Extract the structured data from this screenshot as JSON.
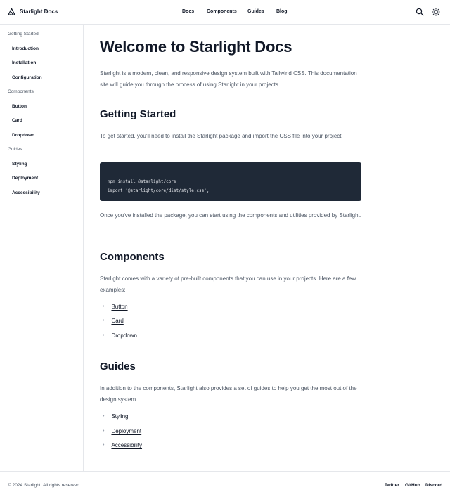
{
  "header": {
    "brand": "Starlight Docs",
    "nav": [
      "Docs",
      "Components",
      "Guides",
      "Blog"
    ],
    "icons": [
      "search-icon",
      "sun-icon"
    ]
  },
  "sidebar": {
    "sections": [
      {
        "title": "Getting Started",
        "items": [
          "Introduction",
          "Installation",
          "Configuration"
        ]
      },
      {
        "title": "Components",
        "items": [
          "Button",
          "Card",
          "Dropdown"
        ]
      },
      {
        "title": "Guides",
        "items": [
          "Styling",
          "Deployment",
          "Accessibility"
        ]
      }
    ]
  },
  "main": {
    "title": "Welcome to Starlight Docs",
    "intro": "Starlight is a modern, clean, and responsive design system built with Tailwind CSS. This documentation site will guide you through the process of using Starlight in your projects.",
    "getting_started": {
      "heading": "Getting Started",
      "text": "To get started, you'll need to install the Starlight package and import the CSS file into your project.",
      "code": [
        "npm install @starlight/core",
        "import '@starlight/core/dist/style.css';"
      ],
      "after": "Once you've installed the package, you can start using the components and utilities provided by Starlight."
    },
    "components": {
      "heading": "Components",
      "text": "Starlight comes with a variety of pre-built components that you can use in your projects. Here are a few examples:",
      "links": [
        "Button",
        "Card",
        "Dropdown"
      ]
    },
    "guides": {
      "heading": "Guides",
      "text": "In addition to the components, Starlight also provides a set of guides to help you get the most out of the design system.",
      "links": [
        "Styling",
        "Deployment",
        "Accessibility"
      ]
    }
  },
  "footer": {
    "copyright": "© 2024 Starlight. All rights reserved.",
    "links": [
      "Twitter",
      "GitHub",
      "Discord"
    ]
  }
}
